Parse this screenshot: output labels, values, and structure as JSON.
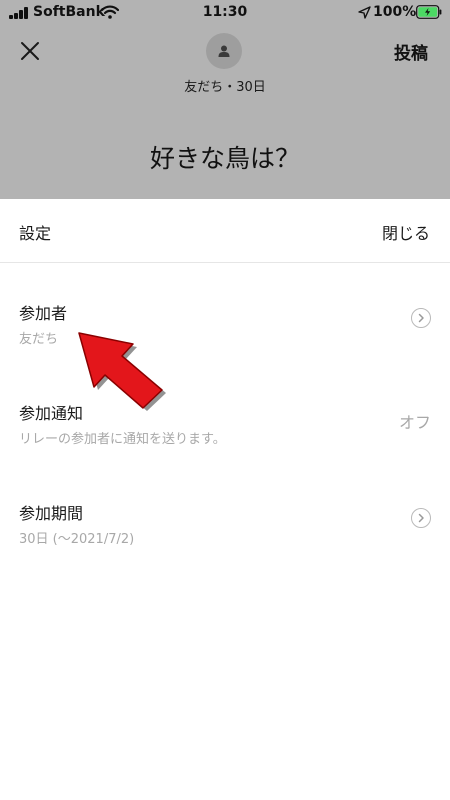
{
  "status_bar": {
    "carrier": "SoftBank",
    "time": "11:30",
    "battery": "100%"
  },
  "header": {
    "subtitle": "友だち・30日",
    "post_label": "投稿",
    "question": "好きな鳥は？"
  },
  "sheet": {
    "title": "設定",
    "close_label": "閉じる",
    "rows": [
      {
        "title": "参加者",
        "subtitle": "友だち"
      },
      {
        "title": "参加通知",
        "subtitle": "リレーの参加者に通知を送ります。",
        "value": "オフ"
      },
      {
        "title": "参加期間",
        "subtitle": "30日 (～2021/7/2)"
      }
    ]
  },
  "colors": {
    "dim_overlay": "#b3b3b3",
    "arrow": "#e3161b",
    "secondary_text": "#a8a8a8"
  }
}
